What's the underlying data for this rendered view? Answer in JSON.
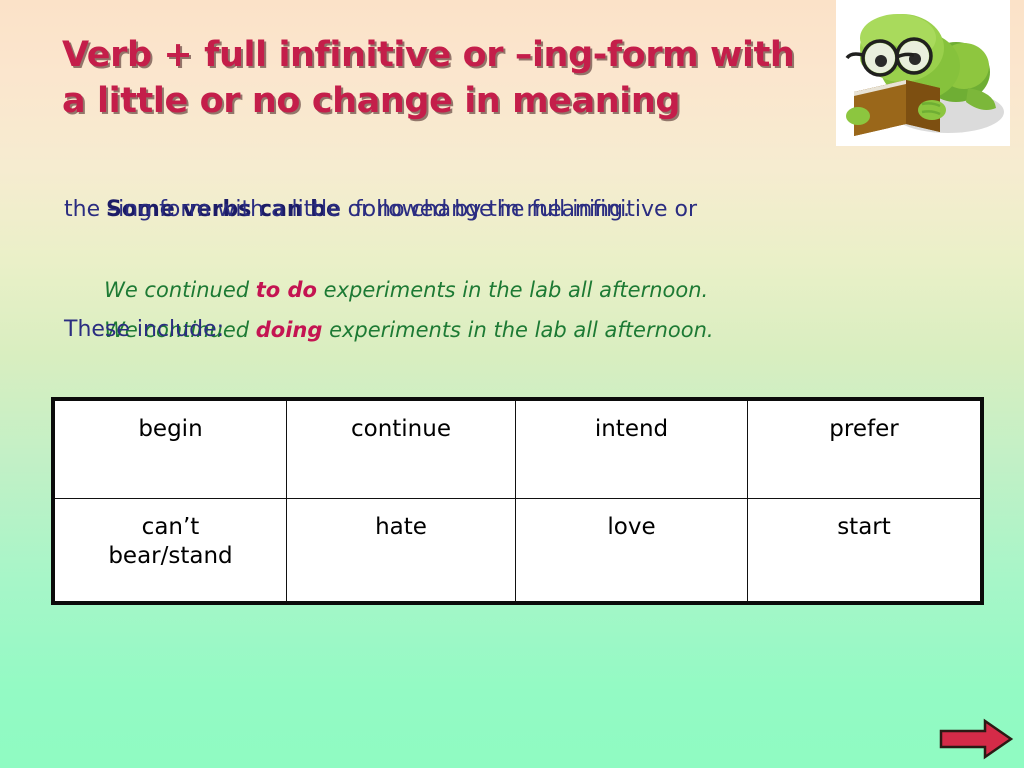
{
  "slide": {
    "background_top_color": "#fbe2c8",
    "background_bottom_color": "#8ffbc2",
    "title": "Verb + full infinitive or –ing-form with\na little or no change in meaning",
    "title_color": "#c41e4a"
  },
  "body": {
    "line1_bold": "Some verbs can be",
    "line1_rest": "  followed by the full infinitive or",
    "line2": "the –ing form with a little or no change in meaning.",
    "example1": {
      "before": "We continued ",
      "highlight": "to do",
      "after": " experiments in the lab all afternoon."
    },
    "example2": {
      "before": "We continued ",
      "highlight": "doing",
      "after": " experiments in the lab all afternoon."
    },
    "line5": "These include:",
    "navy_color": "#2b2d81",
    "green_color": "#1d7a34",
    "highlight_color": "#c41452"
  },
  "table": {
    "rows": [
      [
        "begin",
        "continue",
        "intend",
        "prefer"
      ],
      [
        "can’t\nbear/stand",
        "hate",
        "love",
        "start"
      ]
    ],
    "border_color": "#0b0b0b",
    "cell_background": "#ffffff"
  },
  "illustration": {
    "name": "reading-frog-image",
    "description": "green frog with glasses reading a brown book",
    "frog_color": "#8cc63f",
    "book_color": "#8a5a14",
    "background": "#ffffff"
  },
  "navigation": {
    "next_arrow_label": "next",
    "next_arrow_color": "#d52b48",
    "next_arrow_outline": "#2b1a14"
  }
}
